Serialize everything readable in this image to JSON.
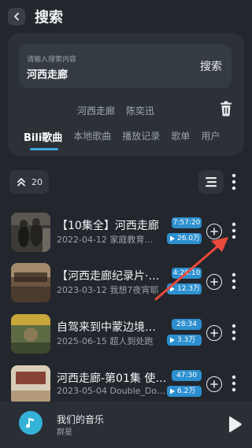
{
  "header": {
    "title": "搜索"
  },
  "search": {
    "placeholder": "请输入搜索内容",
    "value": "河西走廊",
    "button_label": "搜索"
  },
  "history": [
    "河西走廊",
    "陈奕迅"
  ],
  "tabs": [
    {
      "label": "Bili歌曲",
      "active": true
    },
    {
      "label": "本地歌曲",
      "active": false
    },
    {
      "label": "播放记录",
      "active": false
    },
    {
      "label": "歌单",
      "active": false
    },
    {
      "label": "用户",
      "active": false
    }
  ],
  "toolbar": {
    "count": "20"
  },
  "songs": [
    {
      "title": "【10集全】河西走廊",
      "subtitle": "2022-04-12 家庭教育…",
      "duration": "7:57:20",
      "plays": "26.0万"
    },
    {
      "title": "【河西走廊纪录片·…",
      "subtitle": "2023-03-12 我想7夜宵耶",
      "duration": "4:20:10",
      "plays": "12.3万"
    },
    {
      "title": "自驾来到中蒙边境…",
      "subtitle": "2025-06-15 超人到处跑",
      "duration": "28:34",
      "plays": "3.3万"
    },
    {
      "title": "河西走廊-第01集 使…",
      "subtitle": "2023-05-04 Double_Dou…",
      "duration": "47:30",
      "plays": "6.2万"
    }
  ],
  "player": {
    "title": "我们的音乐",
    "artist": "群星"
  },
  "colors": {
    "background": "#23272d",
    "accent": "#2c8fcf",
    "arrow": "#e8493c"
  }
}
